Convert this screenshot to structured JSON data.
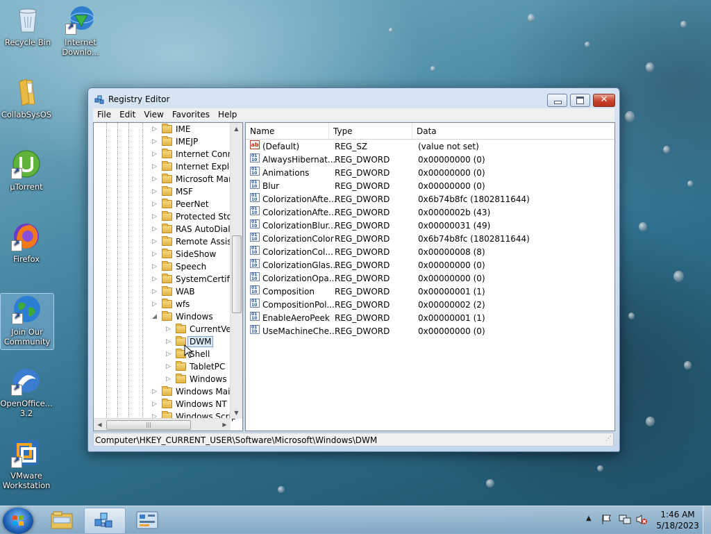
{
  "desktop": {
    "icons": [
      {
        "label": "Recycle Bin",
        "icon": "recycle-bin-icon"
      },
      {
        "label": "Internet Downlo...",
        "icon": "internet-download-manager-icon"
      },
      {
        "label": "CollabSysOS",
        "icon": "folder-icon"
      },
      {
        "label": "µTorrent",
        "icon": "utorrent-icon"
      },
      {
        "label": "Firefox",
        "icon": "firefox-icon"
      },
      {
        "label": "Join Our Community",
        "icon": "globe-icon"
      },
      {
        "label": "OpenOffice... 3.2",
        "icon": "openoffice-icon"
      },
      {
        "label": "VMware Workstation",
        "icon": "vmware-icon"
      }
    ]
  },
  "window": {
    "title": "Registry Editor",
    "menu": [
      "File",
      "Edit",
      "View",
      "Favorites",
      "Help"
    ],
    "tree": [
      {
        "label": "IME",
        "level": 0
      },
      {
        "label": "IMEJP",
        "level": 0
      },
      {
        "label": "Internet Conne",
        "level": 0
      },
      {
        "label": "Internet Explor",
        "level": 0
      },
      {
        "label": "Microsoft Man",
        "level": 0
      },
      {
        "label": "MSF",
        "level": 0
      },
      {
        "label": "PeerNet",
        "level": 0
      },
      {
        "label": "Protected Stor",
        "level": 0
      },
      {
        "label": "RAS AutoDial",
        "level": 0
      },
      {
        "label": "Remote Assista",
        "level": 0
      },
      {
        "label": "SideShow",
        "level": 0
      },
      {
        "label": "Speech",
        "level": 0
      },
      {
        "label": "SystemCertific",
        "level": 0
      },
      {
        "label": "WAB",
        "level": 0
      },
      {
        "label": "wfs",
        "level": 0
      },
      {
        "label": "Windows",
        "level": 0,
        "expanded": true
      },
      {
        "label": "CurrentVer",
        "level": 1
      },
      {
        "label": "DWM",
        "level": 1,
        "selected": true
      },
      {
        "label": "Shell",
        "level": 1
      },
      {
        "label": "TabletPC",
        "level": 1
      },
      {
        "label": "Windows E",
        "level": 1
      },
      {
        "label": "Windows Mail",
        "level": 0
      },
      {
        "label": "Windows NT",
        "level": 0
      },
      {
        "label": "Windows Scrip",
        "level": 0
      }
    ],
    "columns": [
      "Name",
      "Type",
      "Data"
    ],
    "values": [
      {
        "name": "(Default)",
        "type": "REG_SZ",
        "data": "(value not set)",
        "kind": "sz"
      },
      {
        "name": "AlwaysHibernat...",
        "type": "REG_DWORD",
        "data": "0x00000000 (0)",
        "kind": "dw"
      },
      {
        "name": "Animations",
        "type": "REG_DWORD",
        "data": "0x00000000 (0)",
        "kind": "dw"
      },
      {
        "name": "Blur",
        "type": "REG_DWORD",
        "data": "0x00000000 (0)",
        "kind": "dw"
      },
      {
        "name": "ColorizationAfte...",
        "type": "REG_DWORD",
        "data": "0x6b74b8fc (1802811644)",
        "kind": "dw"
      },
      {
        "name": "ColorizationAfte...",
        "type": "REG_DWORD",
        "data": "0x0000002b (43)",
        "kind": "dw"
      },
      {
        "name": "ColorizationBlur...",
        "type": "REG_DWORD",
        "data": "0x00000031 (49)",
        "kind": "dw"
      },
      {
        "name": "ColorizationColor",
        "type": "REG_DWORD",
        "data": "0x6b74b8fc (1802811644)",
        "kind": "dw"
      },
      {
        "name": "ColorizationCol...",
        "type": "REG_DWORD",
        "data": "0x00000008 (8)",
        "kind": "dw"
      },
      {
        "name": "ColorizationGlas...",
        "type": "REG_DWORD",
        "data": "0x00000000 (0)",
        "kind": "dw"
      },
      {
        "name": "ColorizationOpa...",
        "type": "REG_DWORD",
        "data": "0x00000000 (0)",
        "kind": "dw"
      },
      {
        "name": "Composition",
        "type": "REG_DWORD",
        "data": "0x00000001 (1)",
        "kind": "dw"
      },
      {
        "name": "CompositionPol...",
        "type": "REG_DWORD",
        "data": "0x00000002 (2)",
        "kind": "dw"
      },
      {
        "name": "EnableAeroPeek",
        "type": "REG_DWORD",
        "data": "0x00000001 (1)",
        "kind": "dw"
      },
      {
        "name": "UseMachineChe...",
        "type": "REG_DWORD",
        "data": "0x00000000 (0)",
        "kind": "dw"
      }
    ],
    "sz_icon_text": "ab",
    "status": "Computer\\HKEY_CURRENT_USER\\Software\\Microsoft\\Windows\\DWM"
  },
  "taskbar": {
    "items": [
      {
        "icon": "windows-explorer-icon",
        "active": false
      },
      {
        "icon": "registry-editor-icon",
        "active": true
      },
      {
        "icon": "control-panel-icon",
        "active": false
      }
    ],
    "tray_icons": [
      "show-hidden-icons-icon",
      "action-center-flag-icon",
      "network-icon",
      "volume-muted-icon"
    ],
    "time": "1:46 AM",
    "date": "5/18/2023"
  }
}
